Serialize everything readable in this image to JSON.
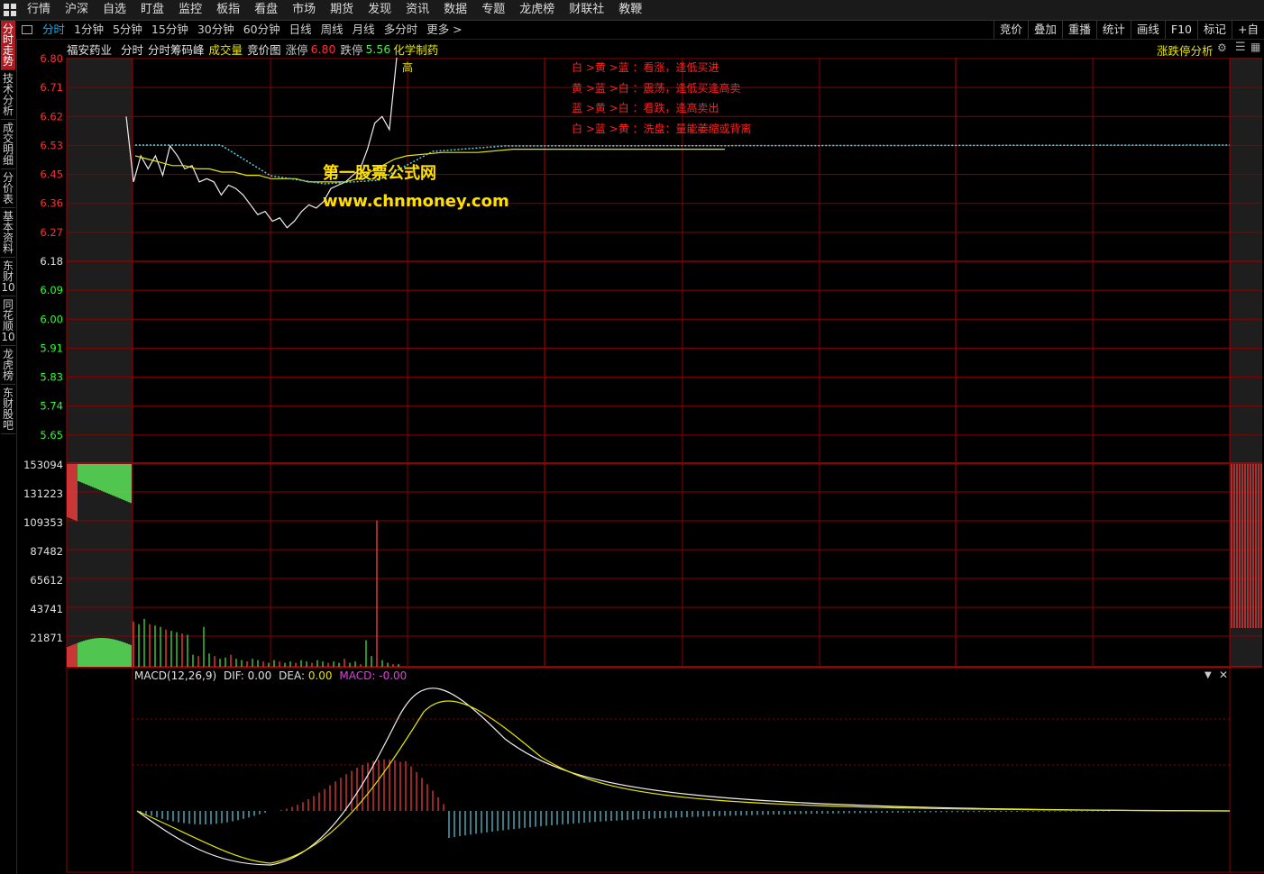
{
  "menu": [
    "行情",
    "沪深",
    "自选",
    "盯盘",
    "监控",
    "板指",
    "看盘",
    "市场",
    "期货",
    "发现",
    "资讯",
    "数据",
    "专题",
    "龙虎榜",
    "财联社",
    "教鞭"
  ],
  "toolbar": {
    "periods": [
      "分时",
      "1分钟",
      "5分钟",
      "15分钟",
      "30分钟",
      "60分钟",
      "日线",
      "周线",
      "月线",
      "多分时",
      "更多 >"
    ],
    "active_period": "分时",
    "right_tools": [
      "竞价",
      "叠加",
      "重播",
      "统计",
      "画线",
      "F10",
      "标记",
      "+自"
    ]
  },
  "sidebar": {
    "tabs": [
      "分时走势",
      "技术分析",
      "成交明细",
      "分价表",
      "基本资料",
      "东财10",
      "同花顺10",
      "龙虎榜",
      "东财股吧"
    ],
    "active": 0
  },
  "info": {
    "stock_name": "福安药业",
    "tab1": "分时",
    "tab2": "分时筹码峰",
    "tab3": "成交量",
    "tab4": "竞价图",
    "limit_up_label": "涨停",
    "limit_up_value": "6.80",
    "limit_down_label": "跌停",
    "limit_down_value": "5.56",
    "sector": "化学制药",
    "right_label": "涨跌停分析"
  },
  "legend": [
    "白 >黄 >蓝 ：看涨，逢低买进",
    "黄 >蓝 >白 ：震荡，逢低买逢高卖",
    "蓝 >黄 >白 ：看跌，逢高卖出",
    "白 >蓝 >黄 ：洗盘：量能萎缩或背离"
  ],
  "watermark": {
    "line1": "第一股票公式网",
    "line2": "www.chnmoney.com"
  },
  "high_marker": "高",
  "macd": {
    "name": "MACD(12,26,9)",
    "dif_label": "DIF:",
    "dif_value": "0.00",
    "dea_label": "DEA:",
    "dea_value": "0.00",
    "macd_label": "MACD:",
    "macd_value": "-0.00"
  },
  "colors": {
    "grid": "#8b0000",
    "up": "#ff4040",
    "down": "#40ff40",
    "price_up_label": "#ff3030",
    "price_down_label": "#30ff30",
    "yellow": "#e6e600",
    "cyan": "#60d0e0",
    "macd_magenta": "#e040e0"
  },
  "chart_data": {
    "type": "line",
    "price_ticks_up": [
      "6.80",
      "6.71",
      "6.62",
      "6.53",
      "6.45",
      "6.36",
      "6.27"
    ],
    "price_ref": "6.18",
    "price_ticks_down": [
      "6.09",
      "6.00",
      "5.91",
      "5.83",
      "5.74",
      "5.65"
    ],
    "volume_ticks": [
      "153094",
      "131223",
      "109353",
      "87482",
      "65612",
      "43741",
      "21871"
    ],
    "price_series": [
      6.62,
      6.42,
      6.5,
      6.46,
      6.5,
      6.44,
      6.53,
      6.5,
      6.46,
      6.47,
      6.42,
      6.43,
      6.42,
      6.38,
      6.41,
      6.4,
      6.38,
      6.35,
      6.32,
      6.33,
      6.3,
      6.31,
      6.28,
      6.3,
      6.33,
      6.35,
      6.34,
      6.36,
      6.4,
      6.41,
      6.42,
      6.44,
      6.46,
      6.52,
      6.6,
      6.62,
      6.58,
      6.8
    ],
    "avg_series": [
      6.5,
      6.49,
      6.48,
      6.47,
      6.47,
      6.46,
      6.46,
      6.45,
      6.45,
      6.44,
      6.44,
      6.43,
      6.43,
      6.43,
      6.42,
      6.42,
      6.42,
      6.42,
      6.43,
      6.45,
      6.47,
      6.49,
      6.5,
      6.51,
      6.51,
      6.52,
      6.52,
      6.52,
      6.52,
      6.52,
      6.52,
      6.52
    ],
    "volume_series": [
      34000,
      32000,
      36000,
      32000,
      31000,
      30000,
      28000,
      27000,
      26000,
      25000,
      24000,
      9000,
      8000,
      30000,
      10000,
      8000,
      6000,
      7000,
      9000,
      6000,
      5000,
      4000,
      6000,
      5000,
      4000,
      3000,
      5000,
      4000,
      3000,
      4000,
      3000,
      5000,
      4000,
      3000,
      5000,
      4000,
      3000,
      4000,
      3000,
      6000,
      3000,
      4000,
      2000,
      20000,
      8000,
      110000,
      5000,
      3000,
      2000,
      2000
    ]
  }
}
